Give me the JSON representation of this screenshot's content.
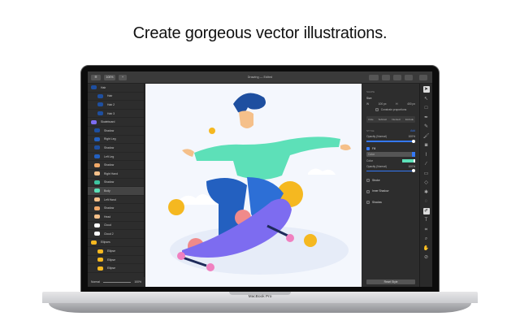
{
  "headline": "Create gorgeous vector illustrations.",
  "device_label": "MacBook Pro",
  "app": {
    "title": "Drawing — Edited",
    "toolbar": {
      "zoom": "100%",
      "add": "+"
    },
    "layers": [
      {
        "name": "Hair",
        "color": "#1e4fa0"
      },
      {
        "name": "Hair",
        "color": "#1e4fa0"
      },
      {
        "name": "Hair 2",
        "color": "#1e4fa0"
      },
      {
        "name": "Hair 3",
        "color": "#1e4fa0"
      },
      {
        "name": "Skateboard",
        "color": "#7d6cf0"
      },
      {
        "name": "Shadow",
        "color": "#1e4fa0"
      },
      {
        "name": "Right Leg",
        "color": "#2360c0"
      },
      {
        "name": "Shadow",
        "color": "#1e4fa0"
      },
      {
        "name": "Left Leg",
        "color": "#2360c0"
      },
      {
        "name": "Shadow",
        "color": "#f0a868"
      },
      {
        "name": "Right Hand",
        "color": "#f5c08a"
      },
      {
        "name": "Shadow",
        "color": "#3fc4a0"
      },
      {
        "name": "Body",
        "color": "#5de0b8"
      },
      {
        "name": "Left Hand",
        "color": "#f5c08a"
      },
      {
        "name": "Shadow",
        "color": "#f0a868"
      },
      {
        "name": "Head",
        "color": "#f5c08a"
      },
      {
        "name": "Cloud",
        "color": "#ffffff"
      },
      {
        "name": "Cloud 2",
        "color": "#ffffff"
      },
      {
        "name": "Ellipses",
        "color": "#f5b820"
      },
      {
        "name": "Ellipse",
        "color": "#f5b820"
      },
      {
        "name": "Ellipse",
        "color": "#f5b820"
      },
      {
        "name": "Ellipse",
        "color": "#f5b820"
      }
    ],
    "selected_layer": "Body",
    "layers_footer": {
      "blend": "Normal",
      "opacity": "100%"
    },
    "inspector": {
      "shape_header": "SHAPE",
      "size_label": "Size",
      "w_label": "W",
      "w_value": "100 px",
      "h_label": "H",
      "h_value": "400 px",
      "constrain": "Constrain proportions",
      "booleans": [
        "Unite",
        "Subtract",
        "Intersect",
        "Exclude"
      ],
      "style_header": "STYLE",
      "style_action": "Add",
      "opacity_label": "Opacity (Normal)",
      "opacity_value": "100%",
      "fill_label": "Fill",
      "fill_type": "Color",
      "color_label": "Color",
      "fill_color": "#5de0b8",
      "fill_opacity_label": "Opacity (Normal)",
      "fill_opacity_value": "100%",
      "stroke_label": "Stroke",
      "inner_shadow_label": "Inner Shadow",
      "shadow_label": "Shadow",
      "reset": "Reset Style"
    },
    "tools": [
      "select",
      "direct-select",
      "rect",
      "pen",
      "pencil",
      "brush",
      "bucket",
      "eyedropper",
      "knife",
      "eraser",
      "shape",
      "star",
      "lasso",
      "paint",
      "text",
      "crop",
      "zoom",
      "hand",
      "picker"
    ]
  }
}
